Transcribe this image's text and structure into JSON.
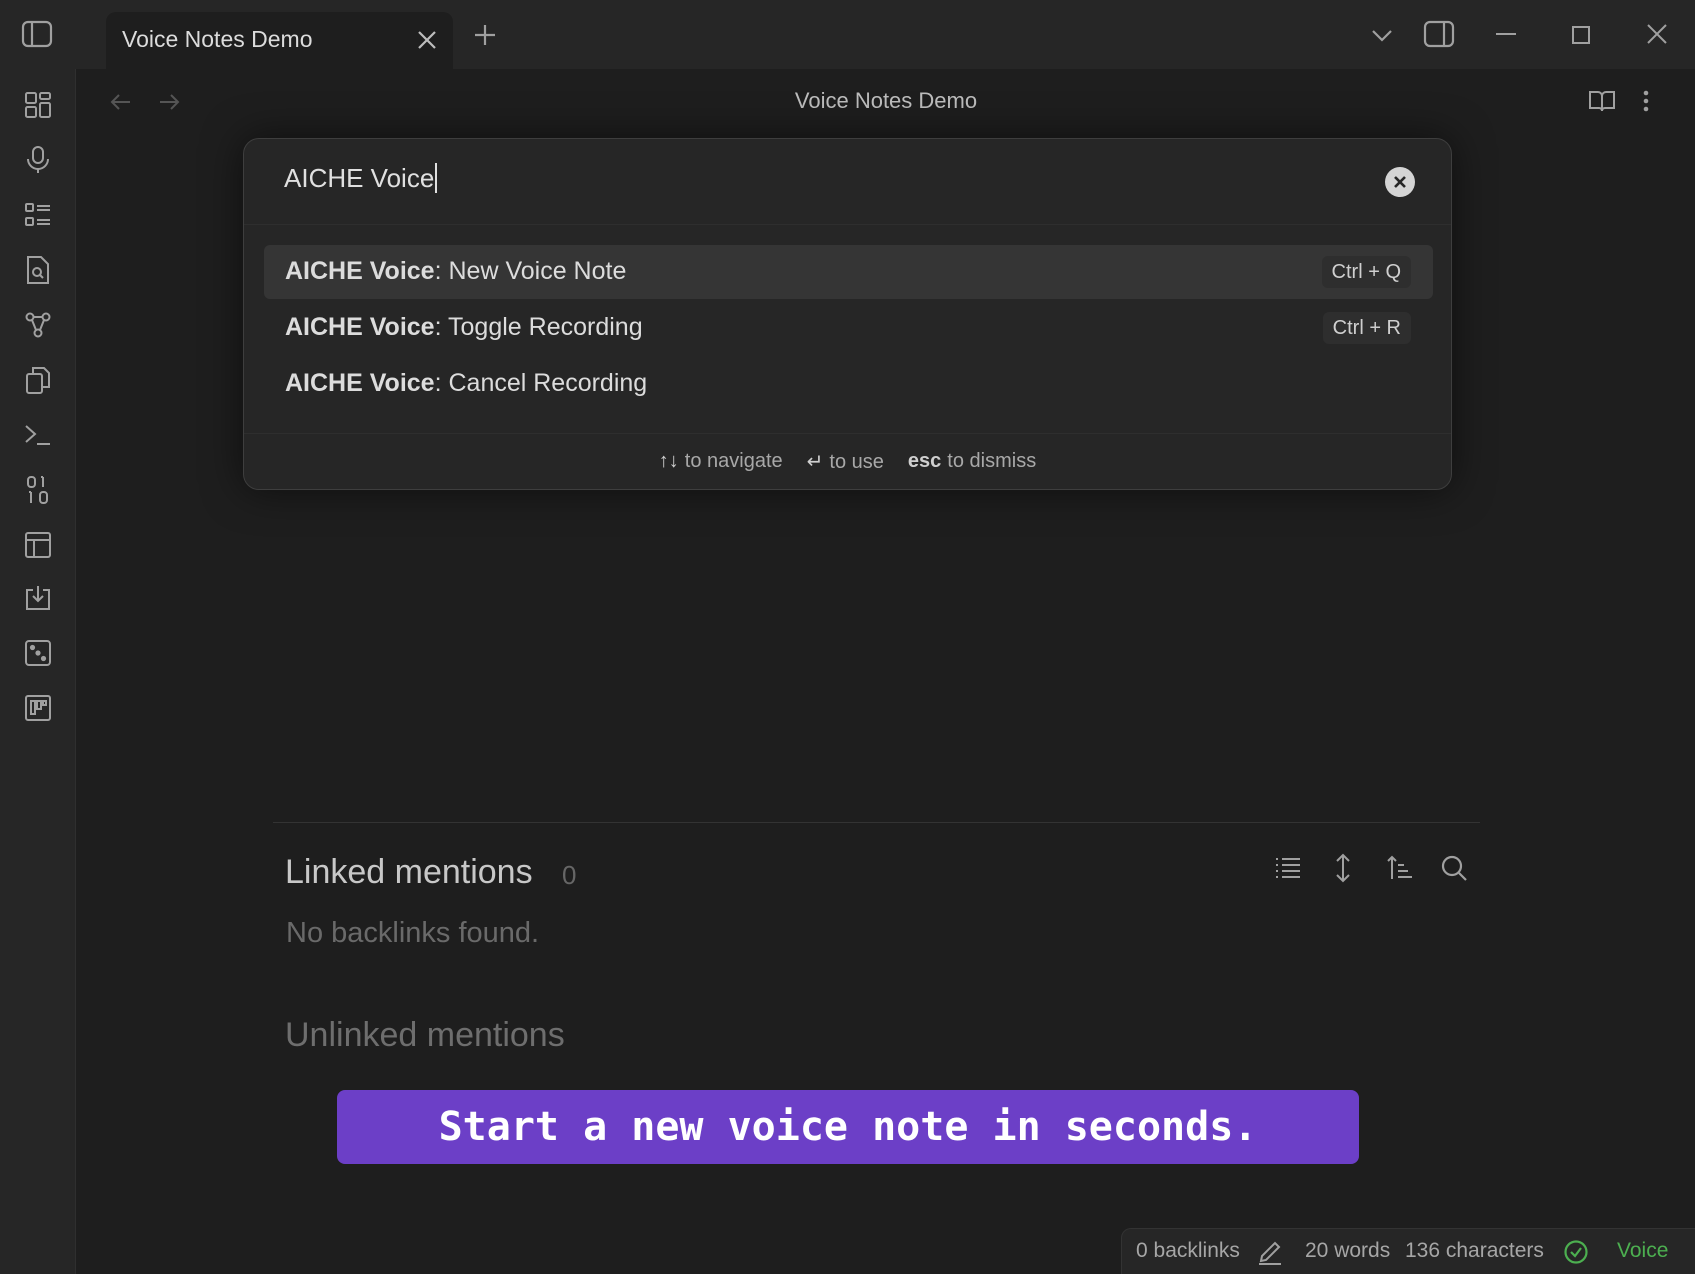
{
  "window": {
    "tab_title": "Voice Notes Demo",
    "icons": [
      "sidebar-toggle-icon",
      "close-icon",
      "plus-icon",
      "chevron-down-icon",
      "right-sidebar-toggle-icon",
      "minimize-icon",
      "maximize-icon",
      "window-close-icon"
    ]
  },
  "ribbon": {
    "items": [
      {
        "icon": "dashboard-icon"
      },
      {
        "icon": "microphone-icon"
      },
      {
        "icon": "list-icon"
      },
      {
        "icon": "file-search-icon"
      },
      {
        "icon": "graph-icon"
      },
      {
        "icon": "copy-icon"
      },
      {
        "icon": "terminal-icon"
      },
      {
        "icon": "binary-icon"
      },
      {
        "icon": "layout-icon"
      },
      {
        "icon": "import-icon"
      },
      {
        "icon": "dice-icon"
      },
      {
        "icon": "kanban-icon"
      }
    ]
  },
  "view": {
    "title": "Voice Notes Demo",
    "icons": [
      "back-arrow-icon",
      "forward-arrow-icon",
      "reading-view-icon",
      "more-options-icon"
    ]
  },
  "palette": {
    "query": "AICHE Voice",
    "suggestions": [
      {
        "prefix": "AICHE Voice",
        "separator": ": ",
        "name": "New Voice Note",
        "hotkey": "Ctrl + Q"
      },
      {
        "prefix": "AICHE Voice",
        "separator": ": ",
        "name": "Toggle Recording",
        "hotkey": "Ctrl + R"
      },
      {
        "prefix": "AICHE Voice",
        "separator": ": ",
        "name": "Cancel Recording",
        "hotkey": ""
      }
    ],
    "instructions": {
      "navigate_key": "↑↓",
      "navigate_text": "to navigate",
      "use_key": "↵",
      "use_text": "to use",
      "dismiss_key": "esc",
      "dismiss_text": "to dismiss"
    }
  },
  "backlinks": {
    "linked_title": "Linked mentions",
    "linked_count": "0",
    "empty_text": "No backlinks found.",
    "unlinked_title": "Unlinked mentions",
    "tool_icons": [
      "list-view-icon",
      "expand-icon",
      "sort-icon",
      "search-icon"
    ]
  },
  "banner": {
    "text": "Start a new voice note in seconds.",
    "color": "#6c3fc7"
  },
  "statusbar": {
    "backlinks": "0 backlinks",
    "words": "20 words",
    "characters": "136 characters",
    "plugin": "Voice",
    "plugin_color": "#4caf50"
  }
}
